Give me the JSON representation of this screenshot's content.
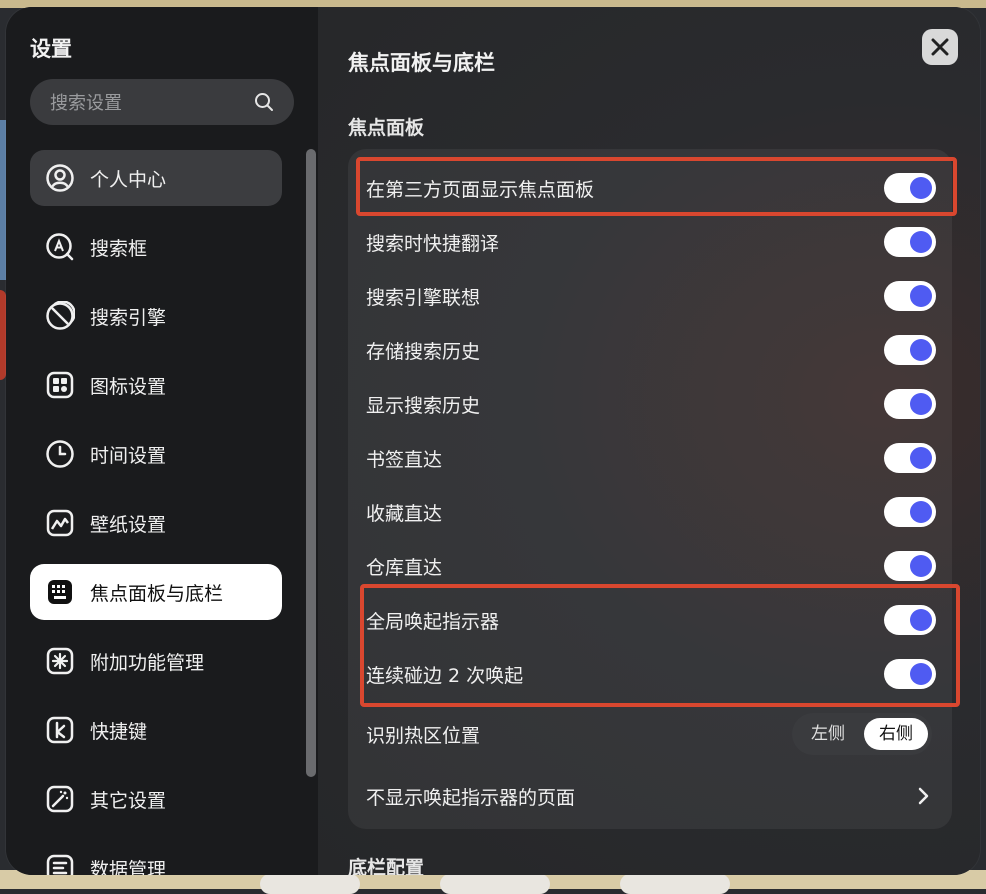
{
  "sidebar": {
    "title": "设置",
    "search_placeholder": "搜索设置",
    "items": [
      {
        "label": "个人中心",
        "icon": "user-circle-icon"
      },
      {
        "label": "搜索框",
        "icon": "search-box-icon"
      },
      {
        "label": "搜索引擎",
        "icon": "search-engine-icon"
      },
      {
        "label": "图标设置",
        "icon": "icon-settings-icon"
      },
      {
        "label": "时间设置",
        "icon": "clock-icon"
      },
      {
        "label": "壁纸设置",
        "icon": "wallpaper-icon"
      },
      {
        "label": "焦点面板与底栏",
        "icon": "keyboard-icon"
      },
      {
        "label": "附加功能管理",
        "icon": "extension-icon"
      },
      {
        "label": "快捷键",
        "icon": "shortcut-key-icon"
      },
      {
        "label": "其它设置",
        "icon": "magic-wand-icon"
      },
      {
        "label": "数据管理",
        "icon": "data-icon"
      }
    ]
  },
  "main": {
    "title": "焦点面板与底栏",
    "section_focus": "焦点面板",
    "section_dock": "底栏配置",
    "rows": [
      {
        "label": "在第三方页面显示焦点面板",
        "enabled": true
      },
      {
        "label": "搜索时快捷翻译",
        "enabled": true
      },
      {
        "label": "搜索引擎联想",
        "enabled": true
      },
      {
        "label": "存储搜索历史",
        "enabled": true
      },
      {
        "label": "显示搜索历史",
        "enabled": true
      },
      {
        "label": "书签直达",
        "enabled": true
      },
      {
        "label": "收藏直达",
        "enabled": true
      },
      {
        "label": "仓库直达",
        "enabled": true
      },
      {
        "label": "全局唤起指示器",
        "enabled": true
      },
      {
        "label": "连续碰边 2 次唤起",
        "enabled": true
      }
    ],
    "hotzone": {
      "label": "识别热区位置",
      "left": "左侧",
      "right": "右侧",
      "selected": "右侧"
    },
    "hidden_pages": {
      "label": "不显示唤起指示器的页面"
    }
  },
  "colors": {
    "accent": "#4f5bf2",
    "highlight": "#d9472f"
  }
}
